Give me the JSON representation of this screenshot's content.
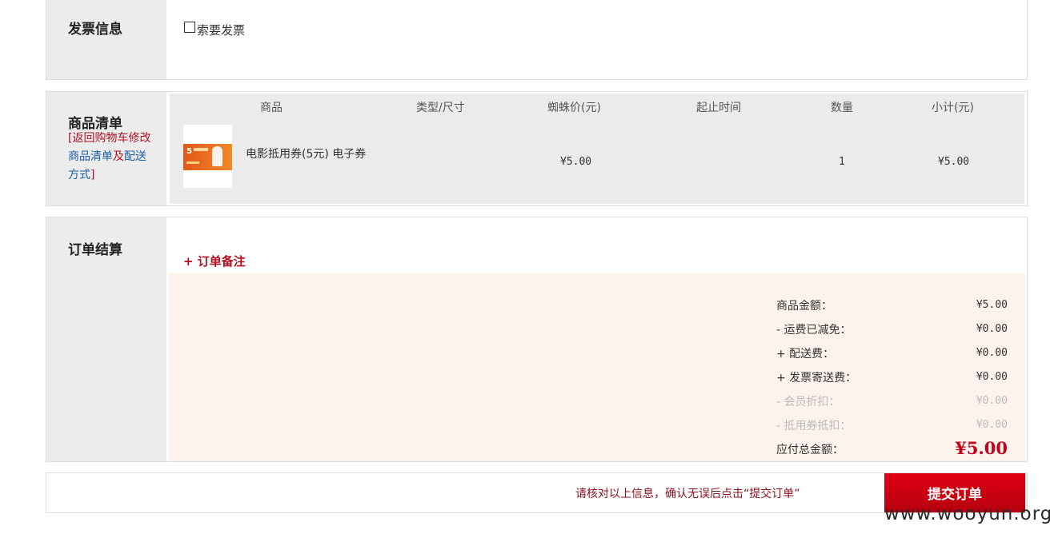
{
  "invoice": {
    "title": "发票信息",
    "checkbox_label": "索要发票",
    "checked": false
  },
  "goods": {
    "title": "商品清单",
    "back_link_open": "[返回购物车修",
    "back_link_mid1": "改",
    "back_link_blue1": "商品清单",
    "back_link_and": "及",
    "back_link_blue2": "配送方式",
    "back_link_close": "]",
    "headers": {
      "product": "商品",
      "type": "类型/尺寸",
      "price": "蜘蛛价(元)",
      "period": "起止时间",
      "qty": "数量",
      "subtotal": "小计(元)"
    },
    "items": [
      {
        "name": "电影抵用券(5元) 电子券",
        "thumb_text": "5",
        "type": "",
        "price": "¥5.00",
        "period": "",
        "qty": "1",
        "subtotal": "¥5.00"
      }
    ]
  },
  "order": {
    "title": "订单结算",
    "note_link": "+ 订单备注",
    "summary": [
      {
        "label": "商品金额：",
        "value": "¥5.00",
        "muted": false
      },
      {
        "label": "- 运费已减免：",
        "value": "¥0.00",
        "muted": false
      },
      {
        "label": "+ 配送费：",
        "value": "¥0.00",
        "muted": false
      },
      {
        "label": "+ 发票寄送费：",
        "value": "¥0.00",
        "muted": false
      },
      {
        "label": "- 会员折扣：",
        "value": "¥0.00",
        "muted": true
      },
      {
        "label": "- 抵用券抵扣：",
        "value": "¥0.00",
        "muted": true
      }
    ],
    "total_label": "应付总金额：",
    "total_value": "¥5.00"
  },
  "submit": {
    "confirm_text": "请核对以上信息，确认无误后点击“提交订单”",
    "button_label": "提交订单"
  },
  "watermark": "www.wooyun.org",
  "colors": {
    "brand_red": "#c4001a",
    "side_gray": "#ececec",
    "summary_bg": "#fdf3ec",
    "link_blue": "#1a5fa8"
  }
}
